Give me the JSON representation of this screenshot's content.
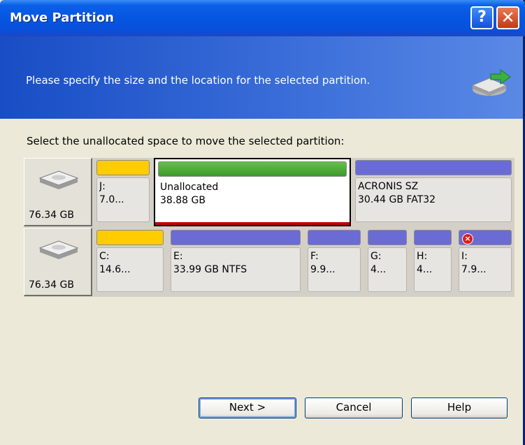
{
  "window": {
    "title": "Move Partition",
    "help_glyph": "?",
    "close_glyph": "✕"
  },
  "banner": {
    "message": "Please specify the size and the location for the selected partition."
  },
  "instruction": "Select the unallocated space to move the selected partition:",
  "disks": [
    {
      "size": "76.34 GB",
      "partitions": [
        {
          "label": "J:",
          "detail": "7.0...",
          "color": "#FFCC00"
        },
        {
          "label": "Unallocated",
          "detail": "38.88 GB",
          "color": "#4CAF35",
          "selected": true
        },
        {
          "label": "ACRONIS SZ",
          "detail": "30.44 GB  FAT32",
          "color": "#6B6BD6"
        }
      ]
    },
    {
      "size": "76.34 GB",
      "partitions": [
        {
          "label": "C:",
          "detail": "14.6...",
          "color": "#FFCC00"
        },
        {
          "label": "E:",
          "detail": "33.99 GB  NTFS",
          "color": "#6B6BD6"
        },
        {
          "label": "F:",
          "detail": "9.9...",
          "color": "#6B6BD6"
        },
        {
          "label": "G:",
          "detail": "4...",
          "color": "#6B6BD6"
        },
        {
          "label": "H:",
          "detail": "4...",
          "color": "#6B6BD6"
        },
        {
          "label": "I:",
          "detail": "7.9...",
          "color": "#6B6BD6",
          "error_icon": true
        }
      ]
    }
  ],
  "buttons": {
    "next": "Next >",
    "cancel": "Cancel",
    "help": "Help"
  },
  "icons": {
    "drive": "drive-move-icon",
    "hdd": "hard-disk-icon",
    "error": "error-badge-icon"
  }
}
